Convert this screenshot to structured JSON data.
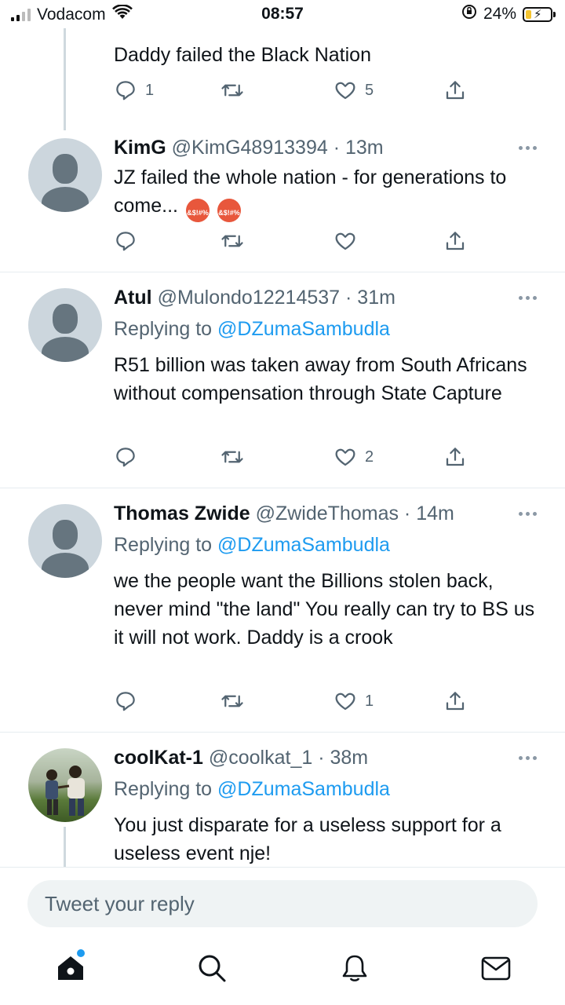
{
  "status_bar": {
    "carrier": "Vodacom",
    "time": "08:57",
    "battery_percent": "24%",
    "signal_bars": 4,
    "signal_bars_active": 2,
    "icons": [
      "signal-icon",
      "wifi-icon",
      "rotation-lock-icon",
      "battery-charging-icon"
    ]
  },
  "colors": {
    "link": "#1d9bf0",
    "secondary_text": "#536471",
    "avatar_bg": "#ccd6dd",
    "battery_fill": "#f4c430"
  },
  "tweets": [
    {
      "text": "Daddy failed the Black Nation",
      "reply_count": "1",
      "like_count": "5",
      "partial": true
    },
    {
      "name": "KimG",
      "handle": "@KimG48913394",
      "time": "· 13m",
      "text": "JZ failed the whole nation - for generations to come...",
      "emojis": [
        "&$!#%",
        "&$!#%"
      ],
      "reply_count": "",
      "like_count": ""
    },
    {
      "name": "Atul",
      "handle": "@Mulondo12214537",
      "time": "· 31m",
      "replying_prefix": "Replying to",
      "replying_to": "@DZumaSambudla",
      "text": "R51 billion was taken  away from South Africans without compensation through State Capture",
      "reply_count": "",
      "like_count": "2"
    },
    {
      "name": "Thomas Zwide",
      "handle": "@ZwideThomas",
      "time": "· 14m",
      "replying_prefix": "Replying to",
      "replying_to": "@DZumaSambudla",
      "text": "we the people want the Billions stolen back, never mind \"the land\" You really can try to BS us it will not work. Daddy is a crook",
      "reply_count": "",
      "like_count": "1"
    },
    {
      "name": "coolKat-1",
      "handle": "@coolkat_1",
      "time": "· 38m",
      "replying_prefix": "Replying to",
      "replying_to": "@DZumaSambudla",
      "text": "You just disparate for a useless support for a useless event nje!"
    }
  ],
  "reply_bar": {
    "placeholder": "Tweet your reply"
  },
  "tabbar": {
    "items": [
      "home-icon",
      "search-icon",
      "notifications-icon",
      "messages-icon"
    ],
    "home_has_new": true
  }
}
